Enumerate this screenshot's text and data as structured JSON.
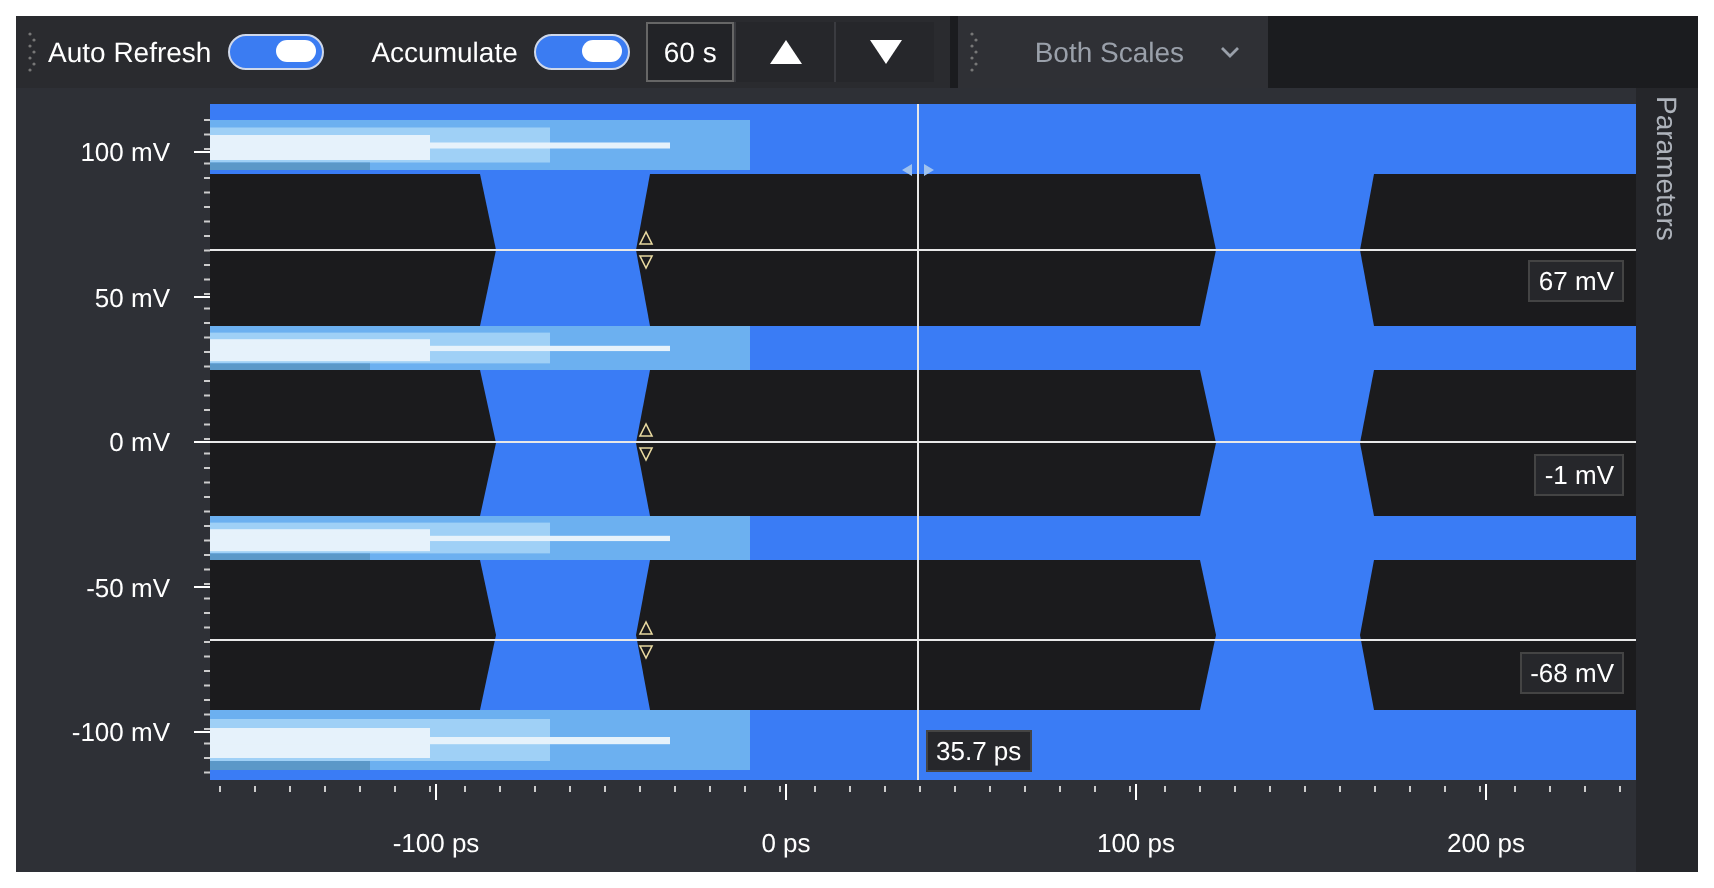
{
  "toolbar": {
    "toggles": [
      {
        "label": "Auto Refresh",
        "on": true
      },
      {
        "label": "Accumulate",
        "on": true
      }
    ],
    "interval": "60 s",
    "scale_dropdown": "Both Scales"
  },
  "plot": {
    "y_axis": [
      "100 mV",
      "50 mV",
      "0 mV",
      "-50 mV",
      "-100 mV"
    ],
    "x_axis": [
      "-100 ps",
      "0 ps",
      "100 ps",
      "200 ps"
    ],
    "cursor_readings": [
      "67 mV",
      "-1 mV",
      "-68 mV"
    ],
    "time_reading": "35.7 ps"
  },
  "side_panel": {
    "label": "Parameters"
  }
}
